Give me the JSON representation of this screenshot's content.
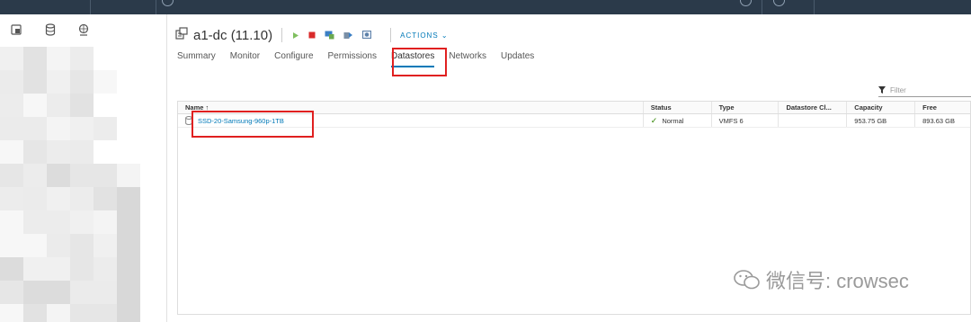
{
  "header": {
    "title": "a1-dc (11.10)",
    "actions_label": "ACTIONS",
    "action_icons": [
      "power-on-icon",
      "power-off-icon",
      "console-icon",
      "migrate-icon",
      "snapshot-icon"
    ]
  },
  "left_nav": {
    "icons": [
      "vms-templates-icon",
      "storage-icon",
      "network-icon"
    ]
  },
  "tabs": [
    {
      "label": "Summary"
    },
    {
      "label": "Monitor"
    },
    {
      "label": "Configure"
    },
    {
      "label": "Permissions"
    },
    {
      "label": "Datastores",
      "active": true
    },
    {
      "label": "Networks"
    },
    {
      "label": "Updates"
    }
  ],
  "filter": {
    "placeholder": "Filter"
  },
  "table": {
    "columns": [
      "Name ↑",
      "Status",
      "Type",
      "Datastore Cl...",
      "Capacity",
      "Free"
    ],
    "rows": [
      {
        "name": "SSD-20-Samsung-960p-1TB",
        "status": "Normal",
        "type": "VMFS 6",
        "cluster": "",
        "capacity": "953.75 GB",
        "free": "893.63 GB"
      }
    ]
  },
  "watermark": {
    "text": "微信号: crowsec"
  },
  "colors": {
    "topbar": "#2b3a4a",
    "accent": "#0079b8",
    "highlight": "#e02020",
    "ok": "#2f8400"
  }
}
